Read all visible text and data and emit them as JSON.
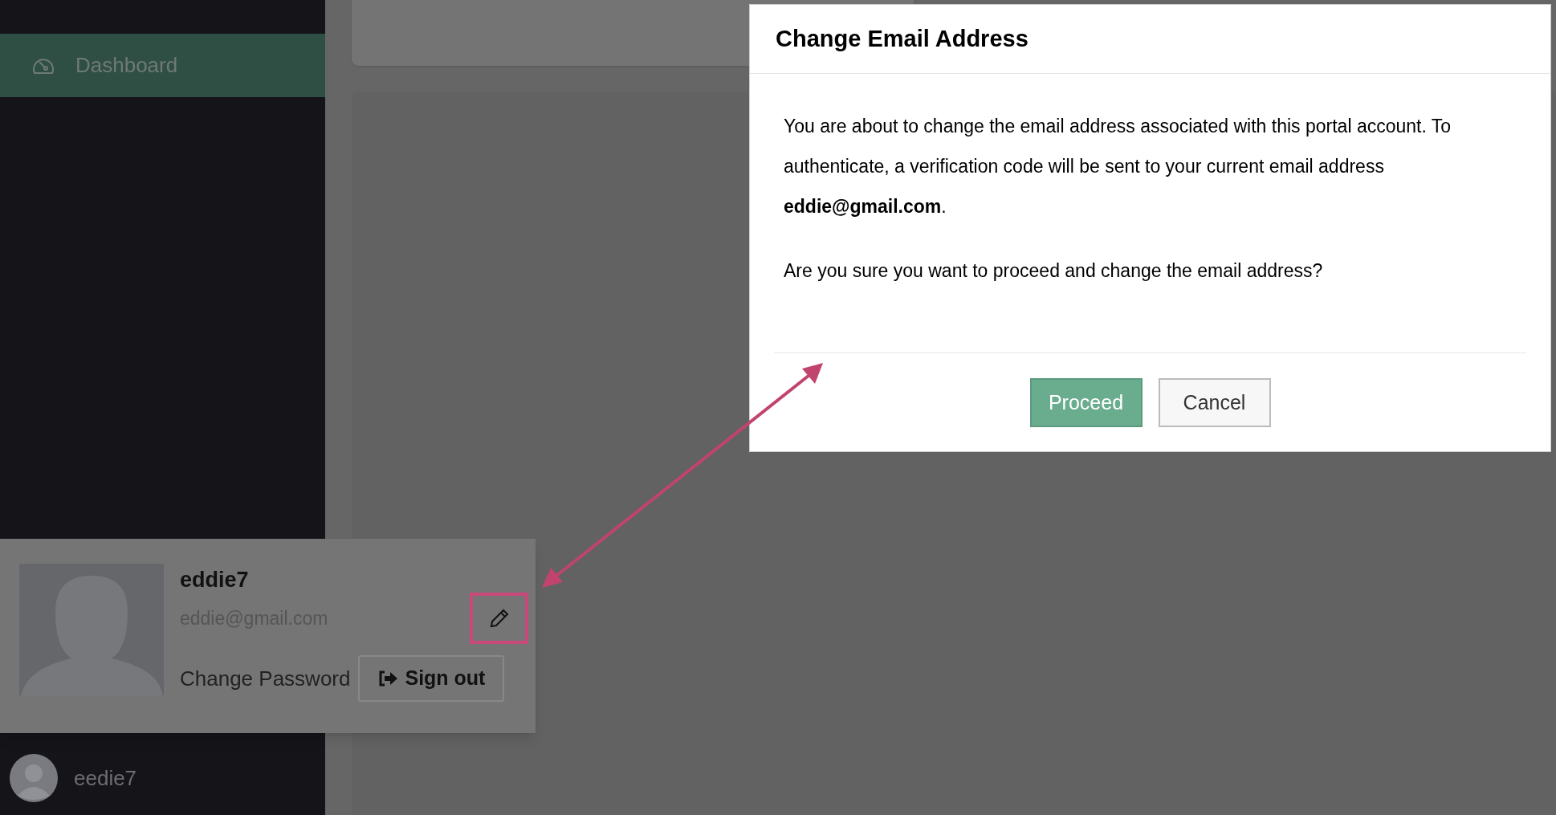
{
  "sidebar": {
    "items": [
      {
        "label": "Dashboard",
        "selected": true
      }
    ],
    "footer_user": "eedie7"
  },
  "profile_popup": {
    "username": "eddie7",
    "email": "eddie@gmail.com",
    "change_password": "Change Password",
    "sign_out": "Sign out"
  },
  "modal": {
    "title": "Change Email Address",
    "paragraphs": [
      "You are about to change the email address associated with this portal account. To authenticate, a verification code will be sent to your current email address **eddie@gmail.com**.",
      "Are you sure you want to proceed and change the email address?"
    ],
    "buttons": [
      {
        "label": "Proceed",
        "kind": "primary"
      },
      {
        "label": "Cancel",
        "kind": "secondary"
      }
    ]
  }
}
